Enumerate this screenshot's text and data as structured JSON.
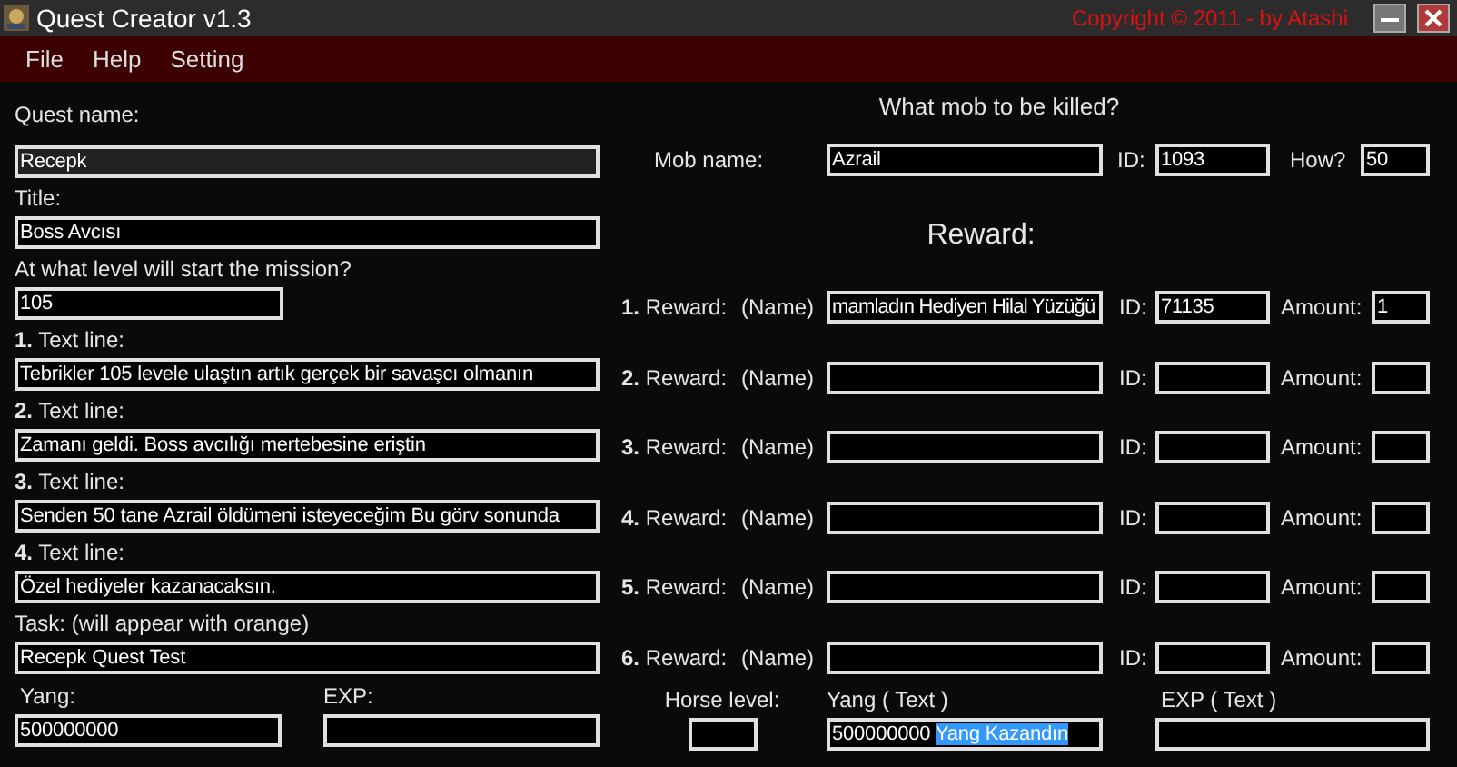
{
  "window": {
    "title": "Quest Creator v1.3",
    "copyright": "Copyright © 2011 - by Atashi"
  },
  "menu": [
    "File",
    "Help",
    "Setting"
  ],
  "left_fields": [
    {
      "label": "Quest name:",
      "value": "Recepk",
      "kind": "wide",
      "focused": true
    },
    {
      "label": "Title:",
      "value": "Boss Avcısı",
      "kind": "wide",
      "focused": false
    },
    {
      "label": "At what level will start the mission?",
      "value": "105",
      "kind": "short",
      "focused": false
    },
    {
      "label": "**1.** Text line:",
      "value": "Tebrikler 105 levele ulaştın artık gerçek bir savaşcı olmanın",
      "kind": "wide",
      "focused": false
    },
    {
      "label": "**2.** Text line:",
      "value": "Zamanı geldi. Boss avcılığı mertebesine eriştin",
      "kind": "wide",
      "focused": false
    },
    {
      "label": "**3.** Text line:",
      "value": "Senden 50 tane Azrail öldümeni isteyeceğim Bu görv sonunda",
      "kind": "wide",
      "focused": false
    },
    {
      "label": "**4.** Text line:",
      "value": "Özel hediyeler kazanacaksın.",
      "kind": "wide",
      "focused": false
    },
    {
      "label": "Task:  (will appear with orange)",
      "value": "Recepk Quest Test",
      "kind": "wide",
      "focused": false
    }
  ],
  "money": [
    {
      "label": "Yang:",
      "value": "500000000"
    },
    {
      "label": "EXP:"
    }
  ],
  "mob": {
    "heading": "What mob to be killed?",
    "name_label": "Mob name:",
    "name": "Azrail",
    "id_label": "ID:",
    "id": "1093",
    "count_label": "How?",
    "count": "50"
  },
  "reward": {
    "heading": "Reward:",
    "rows": [
      {
        "label": "**1.** Reward:",
        "hint": "(Name)",
        "name": "mamladın Hediyen Hilal Yüzüğü",
        "id_label": "ID:",
        "id": "71135",
        "amount_label": "Amount:",
        "amount": "1"
      },
      {
        "label": "**2.** Reward:",
        "hint": "(Name)",
        "id_label": "ID:",
        "amount_label": "Amount:"
      },
      {
        "label": "**3.** Reward:",
        "hint": "(Name)",
        "id_label": "ID:",
        "amount_label": "Amount:"
      },
      {
        "label": "**4.** Reward:",
        "hint": "(Name)",
        "id_label": "ID:",
        "amount_label": "Amount:"
      },
      {
        "label": "**5.** Reward:",
        "hint": "(Name)",
        "id_label": "ID:",
        "amount_label": "Amount:"
      },
      {
        "label": "**6.** Reward:",
        "hint": "(Name)",
        "id_label": "ID:",
        "amount_label": "Amount:"
      }
    ]
  },
  "horse_level": {
    "label": "Horse level:"
  },
  "yang_text": {
    "label": "Yang ( Text )",
    "value": "500000000 ",
    "selected_text": "Yang Kazandın"
  },
  "exp_text": {
    "label": "EXP ( Text )"
  }
}
